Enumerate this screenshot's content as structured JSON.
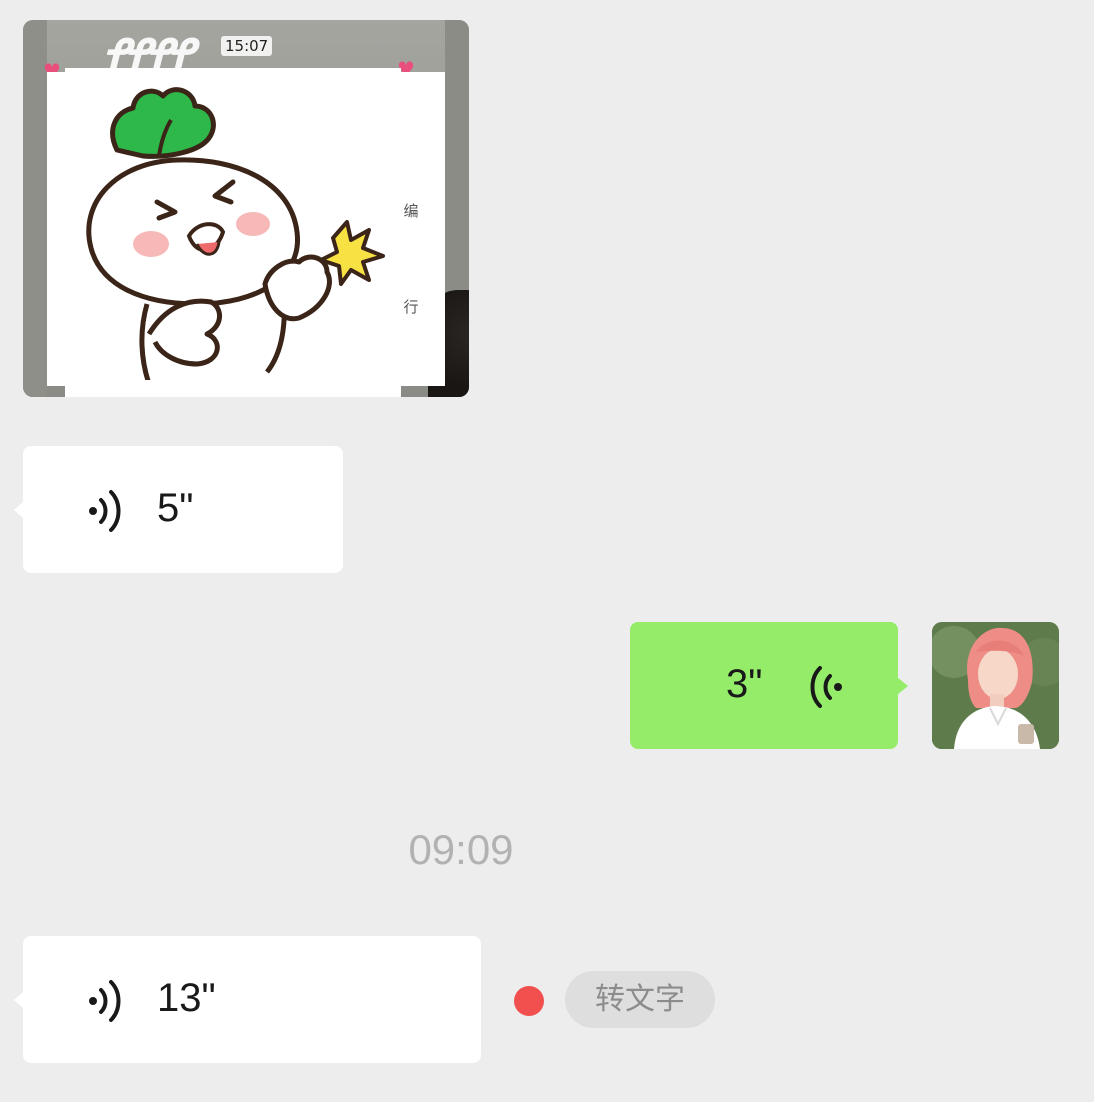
{
  "image_message": {
    "timestamp": "15:07",
    "side_text_1": "编",
    "side_text_2": "行"
  },
  "messages": [
    {
      "direction": "incoming",
      "type": "voice",
      "duration": "5\""
    },
    {
      "direction": "outgoing",
      "type": "voice",
      "duration": "3\""
    },
    {
      "direction": "incoming",
      "type": "voice",
      "duration": "13\""
    }
  ],
  "time_divider": "09:09",
  "transcribe_label": "转文字",
  "colors": {
    "background": "#ededed",
    "outgoing_bubble": "#95ec69",
    "incoming_bubble": "#ffffff",
    "unread_dot": "#f24f4f"
  },
  "icons": [
    "voice-wave-icon",
    "unread-dot-icon"
  ]
}
